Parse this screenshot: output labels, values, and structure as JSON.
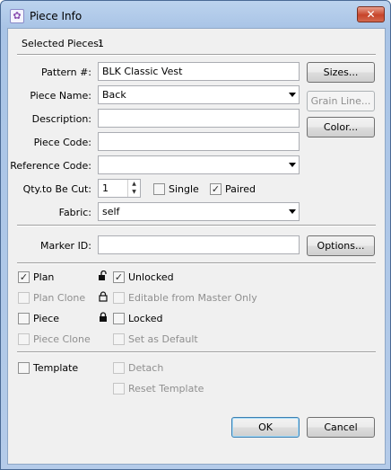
{
  "window": {
    "title": "Piece Info",
    "close_glyph": "✕"
  },
  "selected": {
    "label": "Selected Pieces:",
    "value": "1"
  },
  "form": {
    "pattern": {
      "label": "Pattern #:",
      "value": "BLK Classic Vest"
    },
    "piece_name": {
      "label": "Piece Name:",
      "value": "Back"
    },
    "description": {
      "label": "Description:",
      "value": ""
    },
    "piece_code": {
      "label": "Piece Code:",
      "value": ""
    },
    "reference_code": {
      "label": "Reference Code:",
      "value": ""
    },
    "qty": {
      "label": "Qty.to Be Cut:",
      "value": "1"
    },
    "single": {
      "label": "Single",
      "checked": false
    },
    "paired": {
      "label": "Paired",
      "checked": true
    },
    "fabric": {
      "label": "Fabric:",
      "value": "self"
    },
    "marker_id": {
      "label": "Marker ID:",
      "value": ""
    }
  },
  "buttons": {
    "sizes": "Sizes...",
    "grain_line": "Grain Line...",
    "color": "Color...",
    "options": "Options...",
    "ok": "OK",
    "cancel": "Cancel"
  },
  "options_left": {
    "plan": {
      "label": "Plan",
      "checked": true,
      "enabled": true
    },
    "plan_clone": {
      "label": "Plan Clone",
      "checked": false,
      "enabled": false
    },
    "piece": {
      "label": "Piece",
      "checked": false,
      "enabled": true
    },
    "piece_clone": {
      "label": "Piece Clone",
      "checked": false,
      "enabled": false
    },
    "template": {
      "label": "Template",
      "checked": false,
      "enabled": true
    }
  },
  "options_right": {
    "unlocked": {
      "label": "Unlocked",
      "checked": true,
      "enabled": true
    },
    "editable_master": {
      "label": "Editable from Master Only",
      "checked": false,
      "enabled": false
    },
    "locked": {
      "label": "Locked",
      "checked": false,
      "enabled": true
    },
    "set_default": {
      "label": "Set as Default",
      "checked": false,
      "enabled": false
    },
    "detach": {
      "label": "Detach",
      "checked": false,
      "enabled": false
    },
    "reset_template": {
      "label": "Reset Template",
      "checked": false,
      "enabled": false
    }
  },
  "glyphs": {
    "check": "✓",
    "spin_up": "▲",
    "spin_down": "▼"
  }
}
